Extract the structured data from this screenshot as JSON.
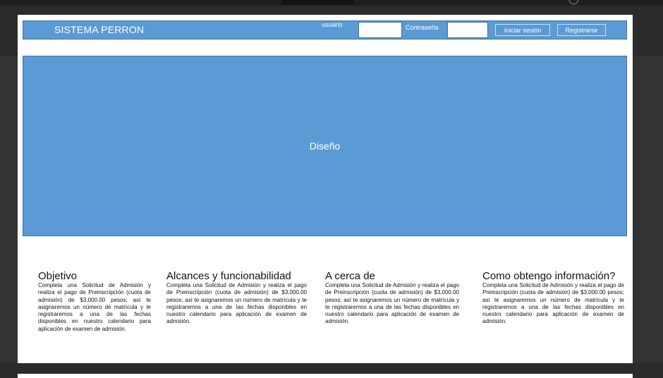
{
  "header": {
    "brand": "SISTEMA PERRON",
    "usuario_label": "usuario",
    "usuario_value": "",
    "password_label": "Contraseña",
    "password_value": "",
    "login_button": "Iniciar sesión",
    "register_button": "Registrarse"
  },
  "hero": {
    "label": "Diseño"
  },
  "columns": [
    {
      "title": "Objetivo",
      "body": "Completa una Solicitud de Admisión y realiza el pago de Preinscripción (cuota de admisión) de $3,000.00 pesos; así te asignaremos un número de matrícula y te registraremos a una de las fechas disponibles en nuestro calendario para aplicación de examen de admisión."
    },
    {
      "title": "Alcances y funcionabilidad",
      "body": "Completa una Solicitud de Admisión y realiza el pago de Preinscripción (cuota de admisión) de $3,000.00 pesos; así te asignaremos un número de matrícula y te registraremos a una de las fechas disponibles en nuestro calendario para aplicación de examen de admisión."
    },
    {
      "title": "A cerca de",
      "body": "Completa una Solicitud de Admisión y realiza el pago de Preinscripción (cuota de admisión) de $3,000.00 pesos; así te asignaremos un número de matrícula y te registraremos a una de las fechas disponibles en nuestro calendario para aplicación de examen de admisión."
    },
    {
      "title": "Como obtengo información?",
      "body": "Completa una Solicitud de Admisión y realiza el pago de Preinscripción (cuota de admisión) de $3,000.00 pesos; así te asignaremos un número de matrícula y te registraremos a una de las fechas disponibles en nuestro calendario para aplicación de examen de admisión."
    }
  ],
  "colors": {
    "accent": "#5b9bd5",
    "accent_border": "#41719c",
    "backdrop": "#2b2b2b"
  }
}
